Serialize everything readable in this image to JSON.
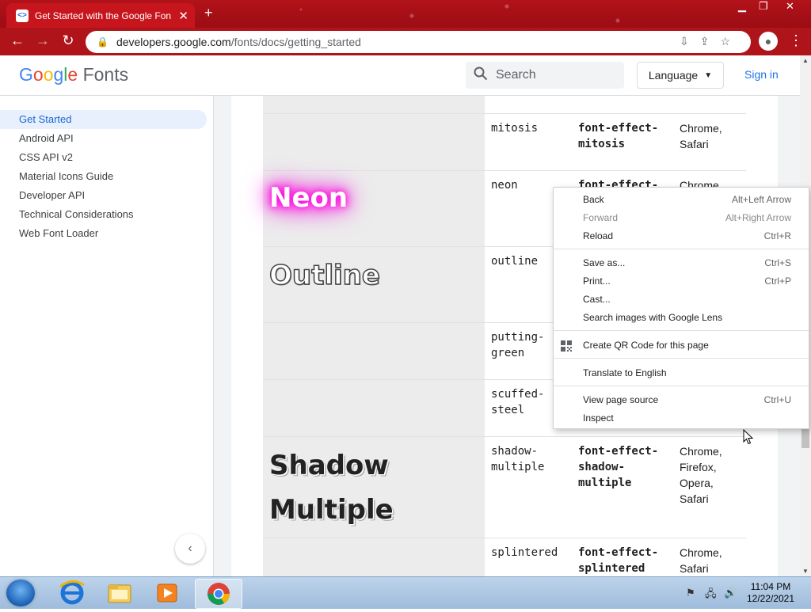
{
  "browser": {
    "tab_title": "Get Started with the Google Fon",
    "tab_close": "✕",
    "new_tab": "+",
    "url_host": "developers.google.com",
    "url_path": "/fonts/docs/getting_started"
  },
  "header": {
    "logo_google": [
      "G",
      "o",
      "o",
      "g",
      "l",
      "e"
    ],
    "logo_product": "Fonts",
    "search_placeholder": "Search",
    "language_label": "Language",
    "signin_label": "Sign in"
  },
  "sidebar": {
    "items": [
      {
        "label": "Get Started",
        "active": true
      },
      {
        "label": "Android API"
      },
      {
        "label": "CSS API v2"
      },
      {
        "label": "Material Icons Guide"
      },
      {
        "label": "Developer API"
      },
      {
        "label": "Technical Considerations"
      },
      {
        "label": "Web Font Loader"
      }
    ]
  },
  "table": {
    "rows": [
      {
        "demo": "",
        "name": "mitosis",
        "class": "font-effect-mitosis",
        "class_lines": [
          "font-effect-",
          "mitosis"
        ],
        "browsers": [
          "Chrome,",
          "Safari"
        ]
      },
      {
        "demo": "Neon",
        "name": "neon",
        "class_lines": [
          "font-effect-",
          ""
        ],
        "browsers": [
          "Chrome",
          ""
        ]
      },
      {
        "demo": "Outline",
        "name": "outline",
        "class_lines": [],
        "browsers": []
      },
      {
        "demo": "",
        "name_lines": [
          "putting-",
          "green"
        ],
        "class_lines": [],
        "browsers": []
      },
      {
        "demo": "",
        "name_lines": [
          "scuffed-",
          "steel"
        ],
        "class_lines": [],
        "browsers": []
      },
      {
        "demo_lines": [
          "Shadow",
          "Multiple"
        ],
        "name_lines": [
          "shadow-",
          "multiple"
        ],
        "class_lines": [
          "font-effect-",
          "shadow-",
          "multiple"
        ],
        "browsers": [
          "Chrome,",
          "Firefox,",
          "Opera,",
          "Safari"
        ]
      },
      {
        "demo": "",
        "name": "splintered",
        "class_lines": [
          "font-effect-",
          "splintered"
        ],
        "browsers": [
          "Chrome,",
          "Safari"
        ]
      }
    ]
  },
  "context_menu": {
    "items": [
      {
        "label": "Back",
        "shortcut": "Alt+Left Arrow"
      },
      {
        "label": "Forward",
        "shortcut": "Alt+Right Arrow",
        "disabled": true
      },
      {
        "label": "Reload",
        "shortcut": "Ctrl+R"
      },
      {
        "label": "Save as...",
        "shortcut": "Ctrl+S"
      },
      {
        "label": "Print...",
        "shortcut": "Ctrl+P"
      },
      {
        "label": "Cast..."
      },
      {
        "label": "Search images with Google Lens"
      },
      {
        "label": "Create QR Code for this page"
      },
      {
        "label": "Translate to English"
      },
      {
        "label": "View page source",
        "shortcut": "Ctrl+U"
      },
      {
        "label": "Inspect"
      }
    ]
  },
  "taskbar": {
    "time": "11:04 PM",
    "date": "12/22/2021"
  }
}
